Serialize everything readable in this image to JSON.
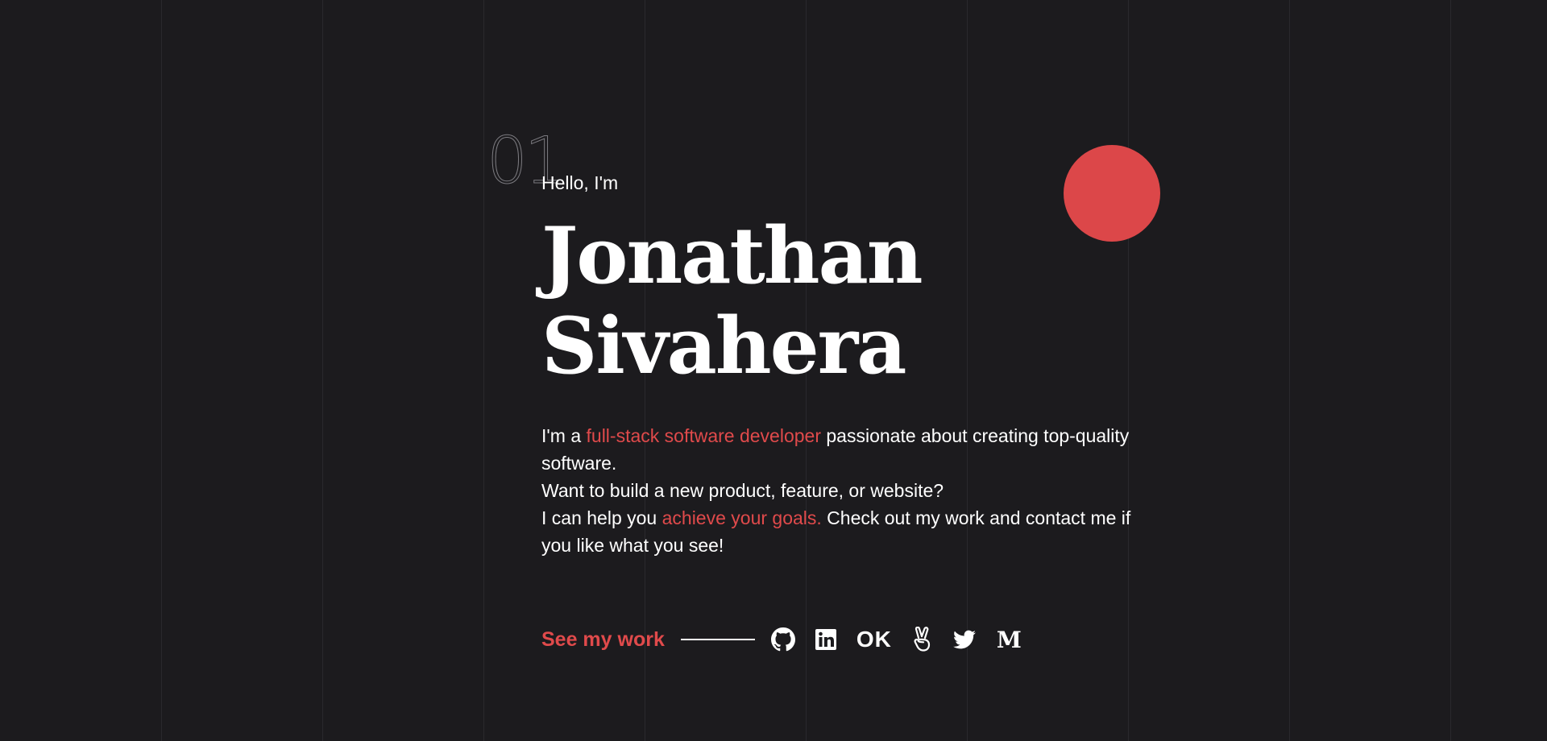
{
  "colors": {
    "background": "#1c1b1e",
    "accent": "#e04a4b",
    "text": "#ffffff",
    "grid_line": "#2a292d"
  },
  "hero": {
    "section_number": "01",
    "greeting": "Hello, I'm",
    "name_line1": "Jonathan",
    "name_line2": "Sivahera",
    "intro": {
      "part1": "I'm a ",
      "highlight1": "full-stack software developer",
      "part2": " passionate about creating top-quality software.",
      "line2": "Want to build a new product, feature, or website?",
      "part3": "I can help you ",
      "highlight2": "achieve your goals.",
      "part4": " Check out my work and contact me if you like what you see!"
    }
  },
  "cta": {
    "see_work_label": "See my work"
  },
  "socials": [
    {
      "name": "github",
      "icon": "github-icon"
    },
    {
      "name": "linkedin",
      "icon": "linkedin-icon"
    },
    {
      "name": "ok",
      "icon": "ok-icon",
      "label": "OK"
    },
    {
      "name": "angellist",
      "icon": "victory-hand-icon"
    },
    {
      "name": "twitter",
      "icon": "twitter-icon"
    },
    {
      "name": "medium",
      "icon": "medium-icon",
      "label": "M"
    }
  ]
}
